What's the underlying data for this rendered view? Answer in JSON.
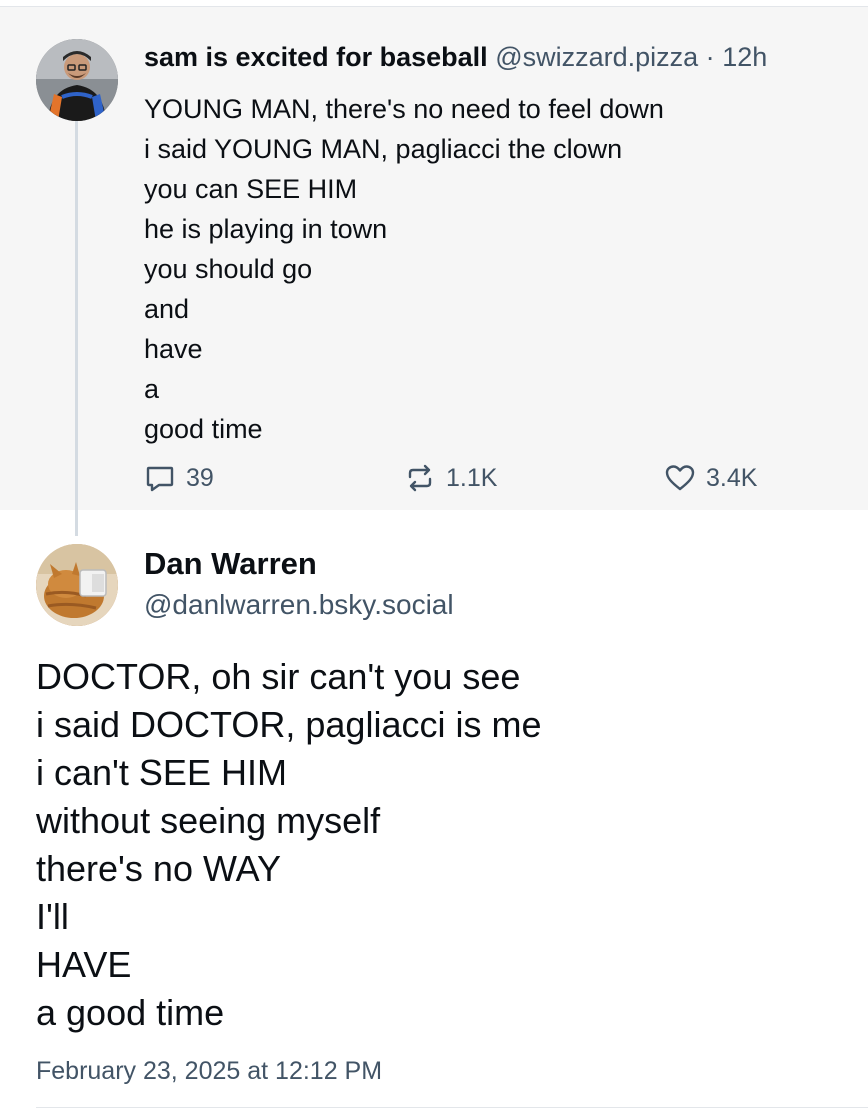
{
  "parent_post": {
    "display_name": "sam is excited for baseball",
    "handle": "@swizzard.pizza",
    "separator": "·",
    "time": "12h",
    "lines": [
      "YOUNG MAN, there's no need to feel down",
      "i said YOUNG MAN, pagliacci the clown",
      "you can SEE HIM",
      "he is playing in town",
      "you should go",
      "and",
      "have",
      "a",
      "good time"
    ],
    "reply_count": "39",
    "repost_count": "1.1K",
    "like_count": "3.4K",
    "avatar_icon": "person-in-mets-jersey-avatar"
  },
  "reply_post": {
    "display_name": "Dan Warren",
    "handle": "@danlwarren.bsky.social",
    "lines": [
      "DOCTOR, oh sir can't you see",
      "i said DOCTOR, pagliacci is me",
      "i can't SEE HIM",
      "without seeing myself",
      "there's no WAY",
      "I'll",
      "HAVE",
      "a good time"
    ],
    "timestamp": "February 23, 2025 at 12:12 PM",
    "avatar_icon": "cat-avatar"
  },
  "colors": {
    "parent_background": "#f6f6f6",
    "text": "#0b0f14",
    "muted": "#425466",
    "thread_line": "#d4dbe2"
  }
}
